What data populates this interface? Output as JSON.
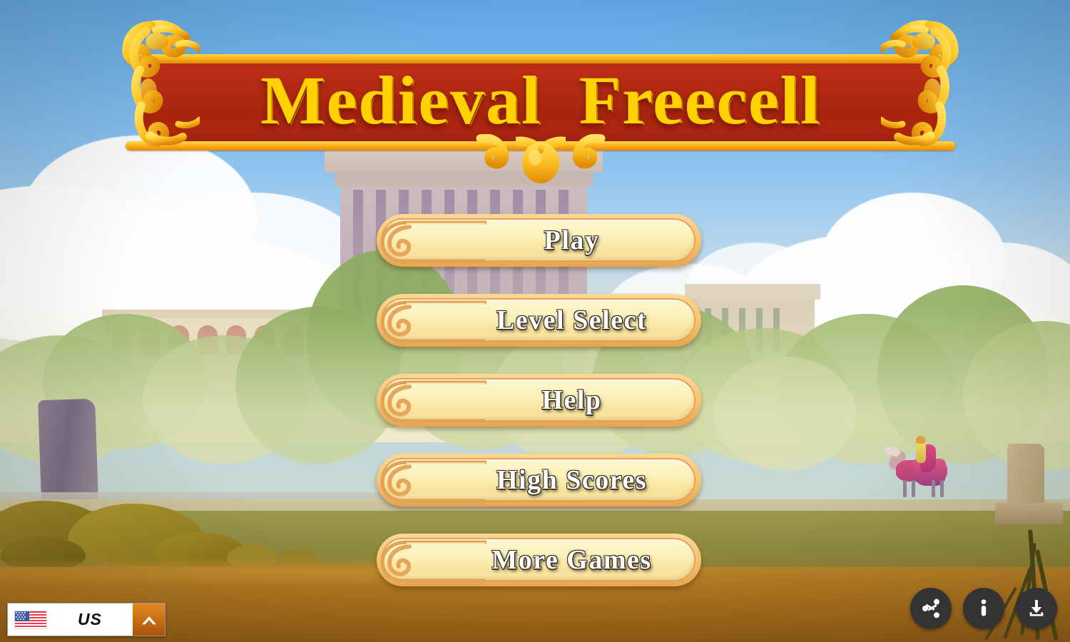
{
  "app": {
    "title": "Medieval  Freecell",
    "title_plain": "Medieval Freecell",
    "screen": "main-menu"
  },
  "colors": {
    "banner_red": "#b32a12",
    "banner_gold": "#ffd200",
    "button_fill": "#fbf0b8",
    "button_border": "#e9a44e",
    "button_text": "#ffffff",
    "lang_toggle_orange": "#c86c12",
    "circle_button_dark": "#333333",
    "sky_blue": "#74b5ec"
  },
  "menu": {
    "buttons": [
      {
        "id": "play",
        "label": "Play"
      },
      {
        "id": "level-select",
        "label": "Level Select"
      },
      {
        "id": "help",
        "label": "Help"
      },
      {
        "id": "high-scores",
        "label": "High Scores"
      },
      {
        "id": "more-games",
        "label": "More Games"
      }
    ]
  },
  "language_bar": {
    "flag": "us-flag-icon",
    "code": "US",
    "toggle_icon": "chevron-up-icon"
  },
  "bottom_right_actions": [
    {
      "id": "share",
      "icon": "share-icon"
    },
    {
      "id": "info",
      "icon": "info-icon"
    },
    {
      "id": "download",
      "icon": "download-icon"
    }
  ],
  "scene": {
    "description": "medieval countryside with classical temple, arcade building, trees, river, standing stone and a rider on horseback",
    "sky": "blue sky with white cumulus clouds",
    "ground": "golden dirt foreground with green grassy bank"
  }
}
